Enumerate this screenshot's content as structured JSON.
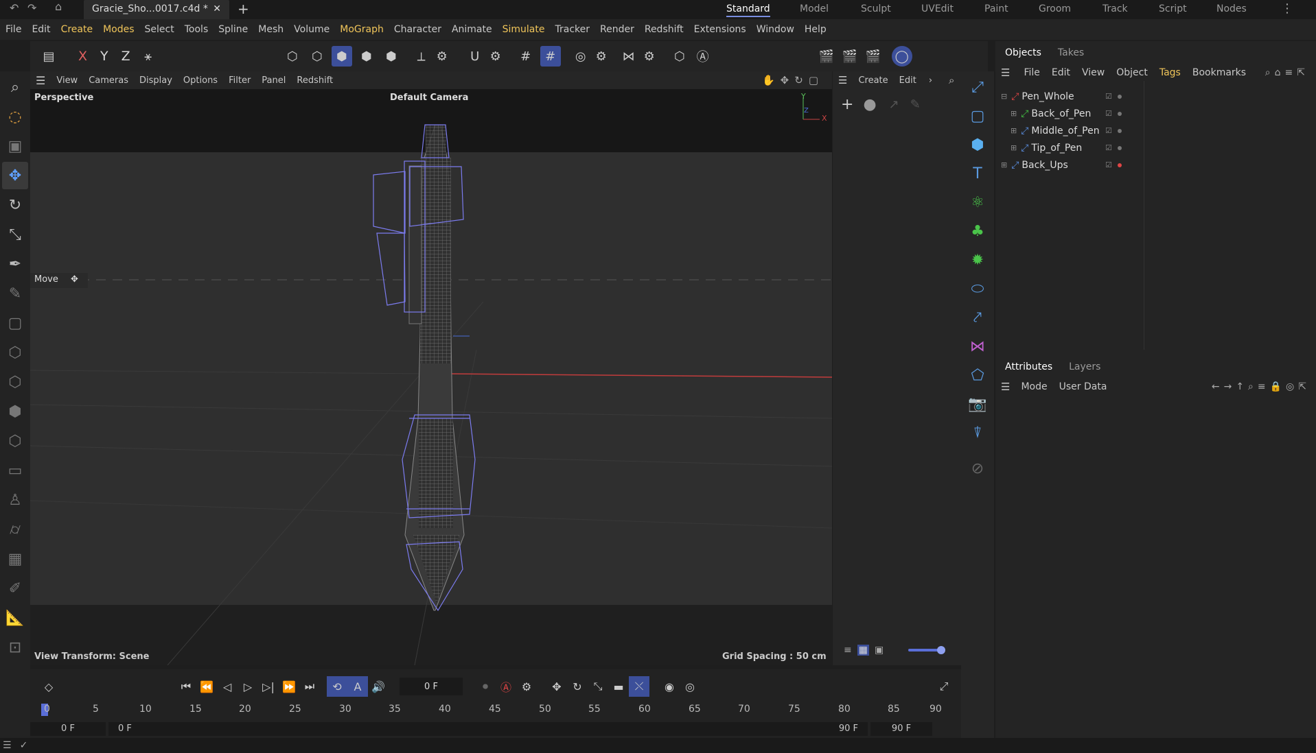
{
  "titlebar": {
    "undo": "↶",
    "redo": "↷",
    "home": "⌂",
    "document_tab": "Gracie_Sho...0017.c4d *",
    "close": "✕",
    "add": "+",
    "layouts": [
      "Standard",
      "Model",
      "Sculpt",
      "UVEdit",
      "Paint",
      "Groom",
      "Track",
      "Script",
      "Nodes"
    ],
    "more": "⋮"
  },
  "menubar": [
    "File",
    "Edit",
    "Create",
    "Modes",
    "Select",
    "Tools",
    "Spline",
    "Mesh",
    "Volume",
    "MoGraph",
    "Character",
    "Animate",
    "Simulate",
    "Tracker",
    "Render",
    "Redshift",
    "Extensions",
    "Window",
    "Help"
  ],
  "toolbar": {
    "x": "X",
    "y": "Y",
    "z": "Z"
  },
  "viewport": {
    "menu": [
      "View",
      "Cameras",
      "Display",
      "Options",
      "Filter",
      "Panel",
      "Redshift"
    ],
    "projection": "Perspective",
    "camera": "Default Camera",
    "move_label": "Move",
    "view_transform": "View Transform: Scene",
    "grid_spacing": "Grid Spacing : 50 cm",
    "axis_y": "Y",
    "axis_x": "X",
    "axis_z": "Z"
  },
  "material_panel": {
    "menu": [
      "Create",
      "Edit"
    ]
  },
  "objects_panel": {
    "tabs": [
      "Objects",
      "Takes"
    ],
    "menu": [
      "File",
      "Edit",
      "View",
      "Object",
      "Tags",
      "Bookmarks"
    ],
    "items": [
      {
        "name": "Pen_Whole",
        "level": 0,
        "icon_color": "#e04545",
        "dot_color": "#777"
      },
      {
        "name": "Back_of_Pen",
        "level": 1,
        "icon_color": "#44c444",
        "dot_color": "#777"
      },
      {
        "name": "Middle_of_Pen",
        "level": 1,
        "icon_color": "#5a8ee0",
        "dot_color": "#777"
      },
      {
        "name": "Tip_of_Pen",
        "level": 1,
        "icon_color": "#5a8ee0",
        "dot_color": "#777"
      },
      {
        "name": "Back_Ups",
        "level": 0,
        "icon_color": "#5a8ee0",
        "dot_color": "#e04545"
      }
    ]
  },
  "attributes_panel": {
    "tabs": [
      "Attributes",
      "Layers"
    ],
    "menu": [
      "Mode",
      "User Data"
    ]
  },
  "timeline": {
    "current_frame": "0 F",
    "ruler": [
      "0",
      "5",
      "10",
      "15",
      "20",
      "25",
      "30",
      "35",
      "40",
      "45",
      "50",
      "55",
      "60",
      "65",
      "70",
      "75",
      "80",
      "85",
      "90"
    ],
    "start": "0 F",
    "preview_start": "0 F",
    "preview_end": "90 F",
    "end": "90 F"
  },
  "colors": {
    "accent": "#7a8de0",
    "highlight": "#f0c55a",
    "active_tool": "#5fa0ff"
  }
}
